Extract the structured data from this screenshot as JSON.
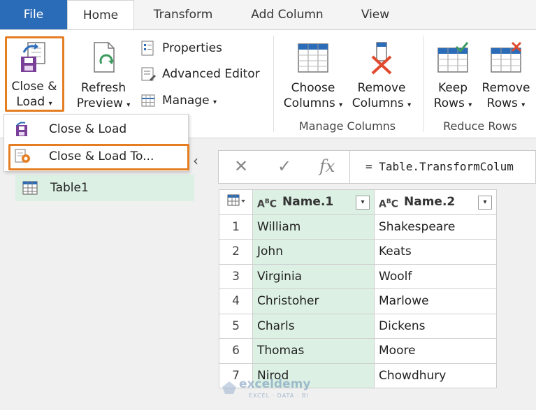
{
  "tabs": [
    "File",
    "Home",
    "Transform",
    "Add Column",
    "View"
  ],
  "ribbon": {
    "close_load": {
      "line1": "Close &",
      "line2": "Load"
    },
    "refresh_preview": {
      "line1": "Refresh",
      "line2": "Preview"
    },
    "properties": "Properties",
    "advanced_editor": "Advanced Editor",
    "manage": "Manage",
    "choose_columns": {
      "line1": "Choose",
      "line2": "Columns"
    },
    "remove_columns": {
      "line1": "Remove",
      "line2": "Columns"
    },
    "keep_rows": {
      "line1": "Keep",
      "line2": "Rows"
    },
    "remove_rows": {
      "line1": "Remove",
      "line2": "Rows"
    },
    "group_manage_columns": "Manage Columns",
    "group_reduce_rows": "Reduce Rows"
  },
  "menu": {
    "close_load": "Close & Load",
    "close_load_to": "Close & Load To..."
  },
  "queries": [
    "Table1"
  ],
  "formula": "= Table.TransformColum",
  "table": {
    "headers": [
      "Name.1",
      "Name.2"
    ],
    "rows": [
      [
        "1",
        "William",
        "Shakespeare"
      ],
      [
        "2",
        "John",
        "Keats"
      ],
      [
        "3",
        "Virginia",
        "Woolf"
      ],
      [
        "4",
        "Christoher",
        "Marlowe"
      ],
      [
        "5",
        "Charls",
        "Dickens"
      ],
      [
        "6",
        "Thomas",
        "Moore"
      ],
      [
        "7",
        "Nirod",
        "Chowdhury"
      ]
    ]
  },
  "watermark": {
    "name": "exceldemy",
    "sub": "EXCEL · DATA · BI"
  },
  "colors": {
    "file_tab": "#2b6cb8",
    "highlight": "#e57e22",
    "selection": "#dcf1e4"
  }
}
